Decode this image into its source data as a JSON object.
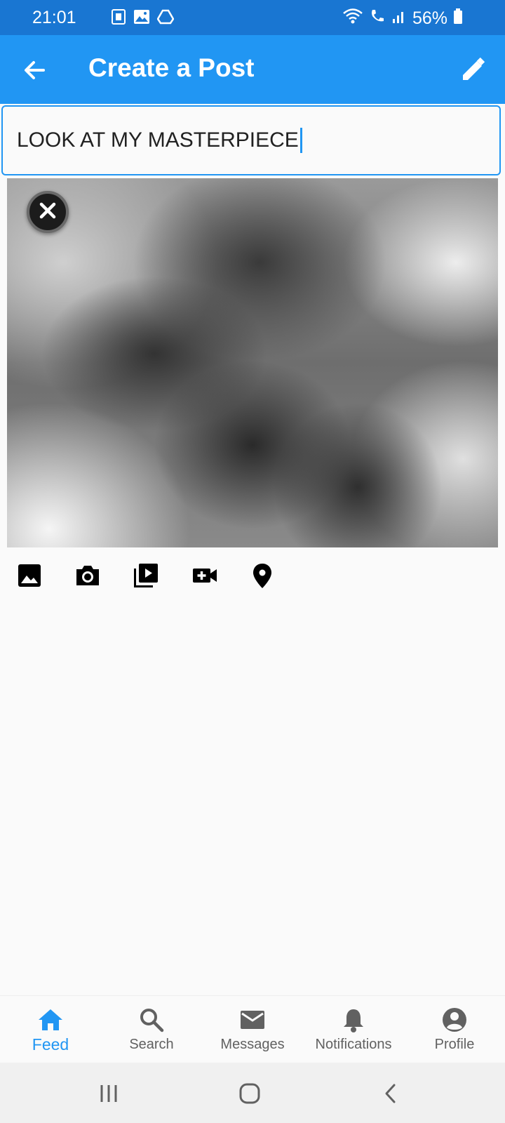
{
  "status_bar": {
    "time": "21:01",
    "battery": "56%",
    "left_icons": [
      "sim-card-icon",
      "gallery-icon",
      "drive-icon"
    ],
    "right_icons": [
      "wifi-icon",
      "call-icon",
      "signal-icon",
      "battery-icon"
    ]
  },
  "app_bar": {
    "title": "Create a Post",
    "back_icon": "arrow-back-icon",
    "action_icon": "edit-icon"
  },
  "post": {
    "text": "LOOK AT MY MASTERPIECE"
  },
  "toolbar": {
    "icons": [
      "gallery-icon",
      "camera-icon",
      "video-library-icon",
      "video-camera-add-icon",
      "location-icon"
    ]
  },
  "bottom_nav": {
    "items": [
      {
        "label": "Feed",
        "icon": "home-icon",
        "active": true
      },
      {
        "label": "Search",
        "icon": "search-icon",
        "active": false
      },
      {
        "label": "Messages",
        "icon": "mail-icon",
        "active": false
      },
      {
        "label": "Notifications",
        "icon": "bell-icon",
        "active": false
      },
      {
        "label": "Profile",
        "icon": "account-icon",
        "active": false
      }
    ]
  },
  "colors": {
    "primary": "#2196f3",
    "status_bar": "#1976d2",
    "active_nav": "#2196f3",
    "inactive_nav": "#616161"
  }
}
